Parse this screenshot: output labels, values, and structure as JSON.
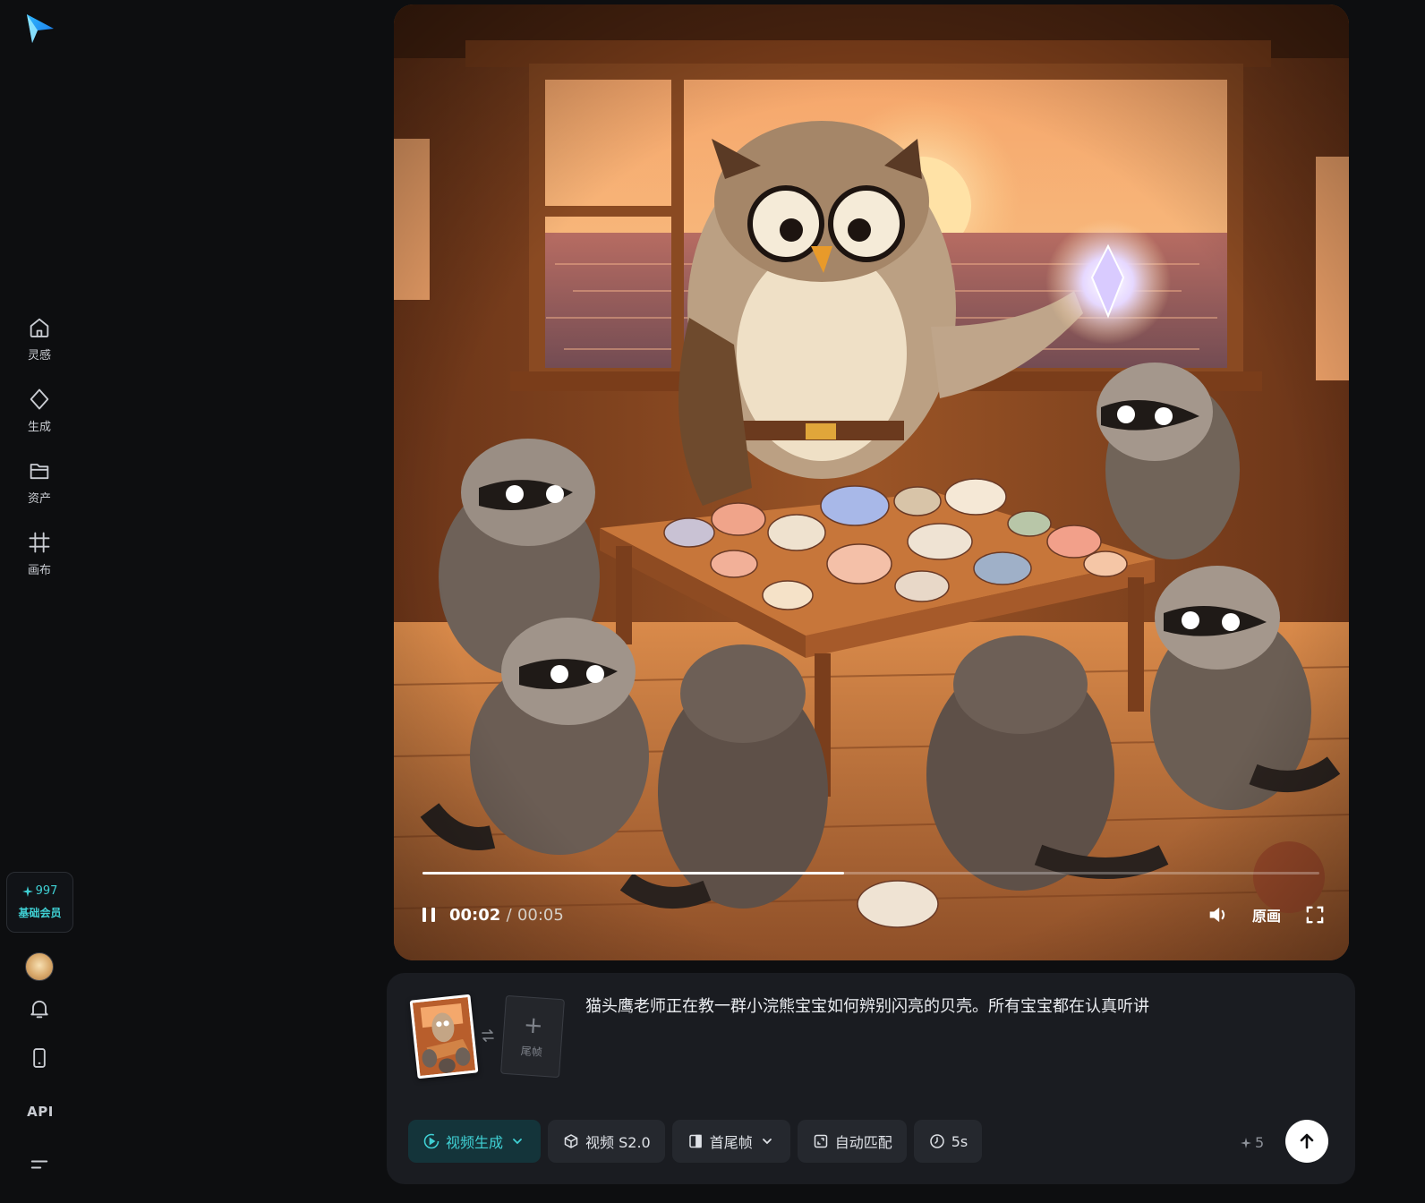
{
  "sidebar": {
    "logo_icon": "paper-plane-logo",
    "nav": [
      {
        "label": "灵感",
        "icon": "home-icon"
      },
      {
        "label": "生成",
        "icon": "diamond-icon"
      },
      {
        "label": "资产",
        "icon": "folder-icon"
      },
      {
        "label": "画布",
        "icon": "canvas-grid-icon"
      }
    ],
    "credits": "997",
    "membership": "基础会员",
    "api_label": "API"
  },
  "player": {
    "state": "playing",
    "current_time": "00:02",
    "separator": "/",
    "duration": "00:05",
    "progress": 0.47,
    "quality_label": "原画"
  },
  "prompt": {
    "text": "猫头鹰老师正在教一群小浣熊宝宝如何辨别闪亮的贝壳。所有宝宝都在认真听讲",
    "end_frame_label": "尾帧",
    "end_frame_plus": "+"
  },
  "toolbar": {
    "mode": "视频生成",
    "model": "视频 S2.0",
    "frames": "首尾帧",
    "ratio": "自动匹配",
    "duration": "5s",
    "cost": "5"
  },
  "colors": {
    "accent": "#3fd0d4",
    "background": "#0d0e10",
    "panel": "#1a1c21",
    "chip": "#25282e"
  }
}
